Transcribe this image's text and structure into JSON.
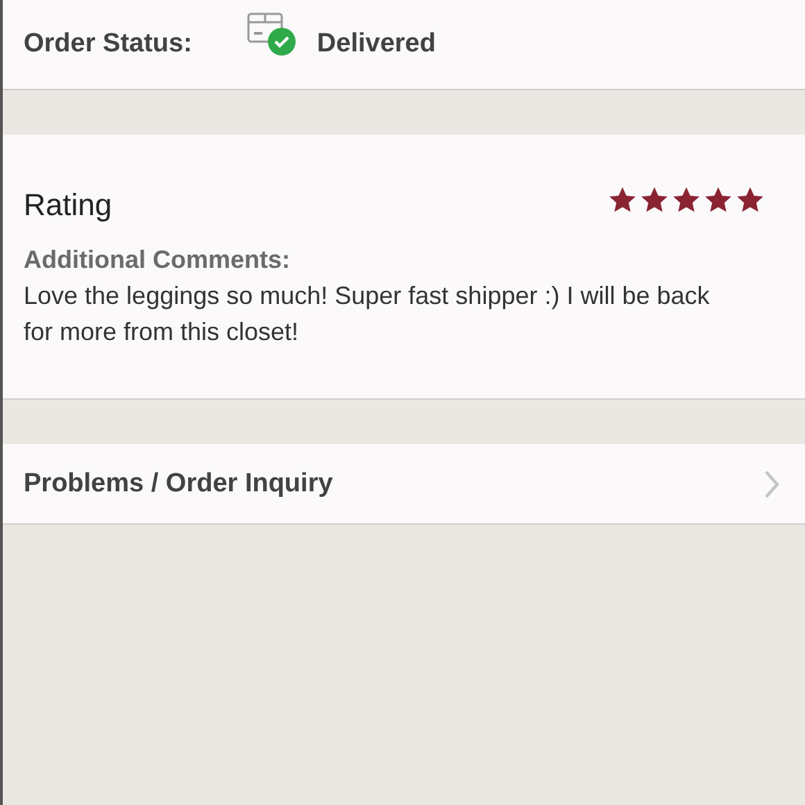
{
  "order_status": {
    "label": "Order Status:",
    "value": "Delivered"
  },
  "rating": {
    "title": "Rating",
    "stars": 5,
    "comments_label": "Additional Comments:",
    "comments": "Love the leggings so much! Super fast shipper :) I will be back for more from this closet!"
  },
  "inquiry": {
    "label": "Problems / Order Inquiry"
  }
}
